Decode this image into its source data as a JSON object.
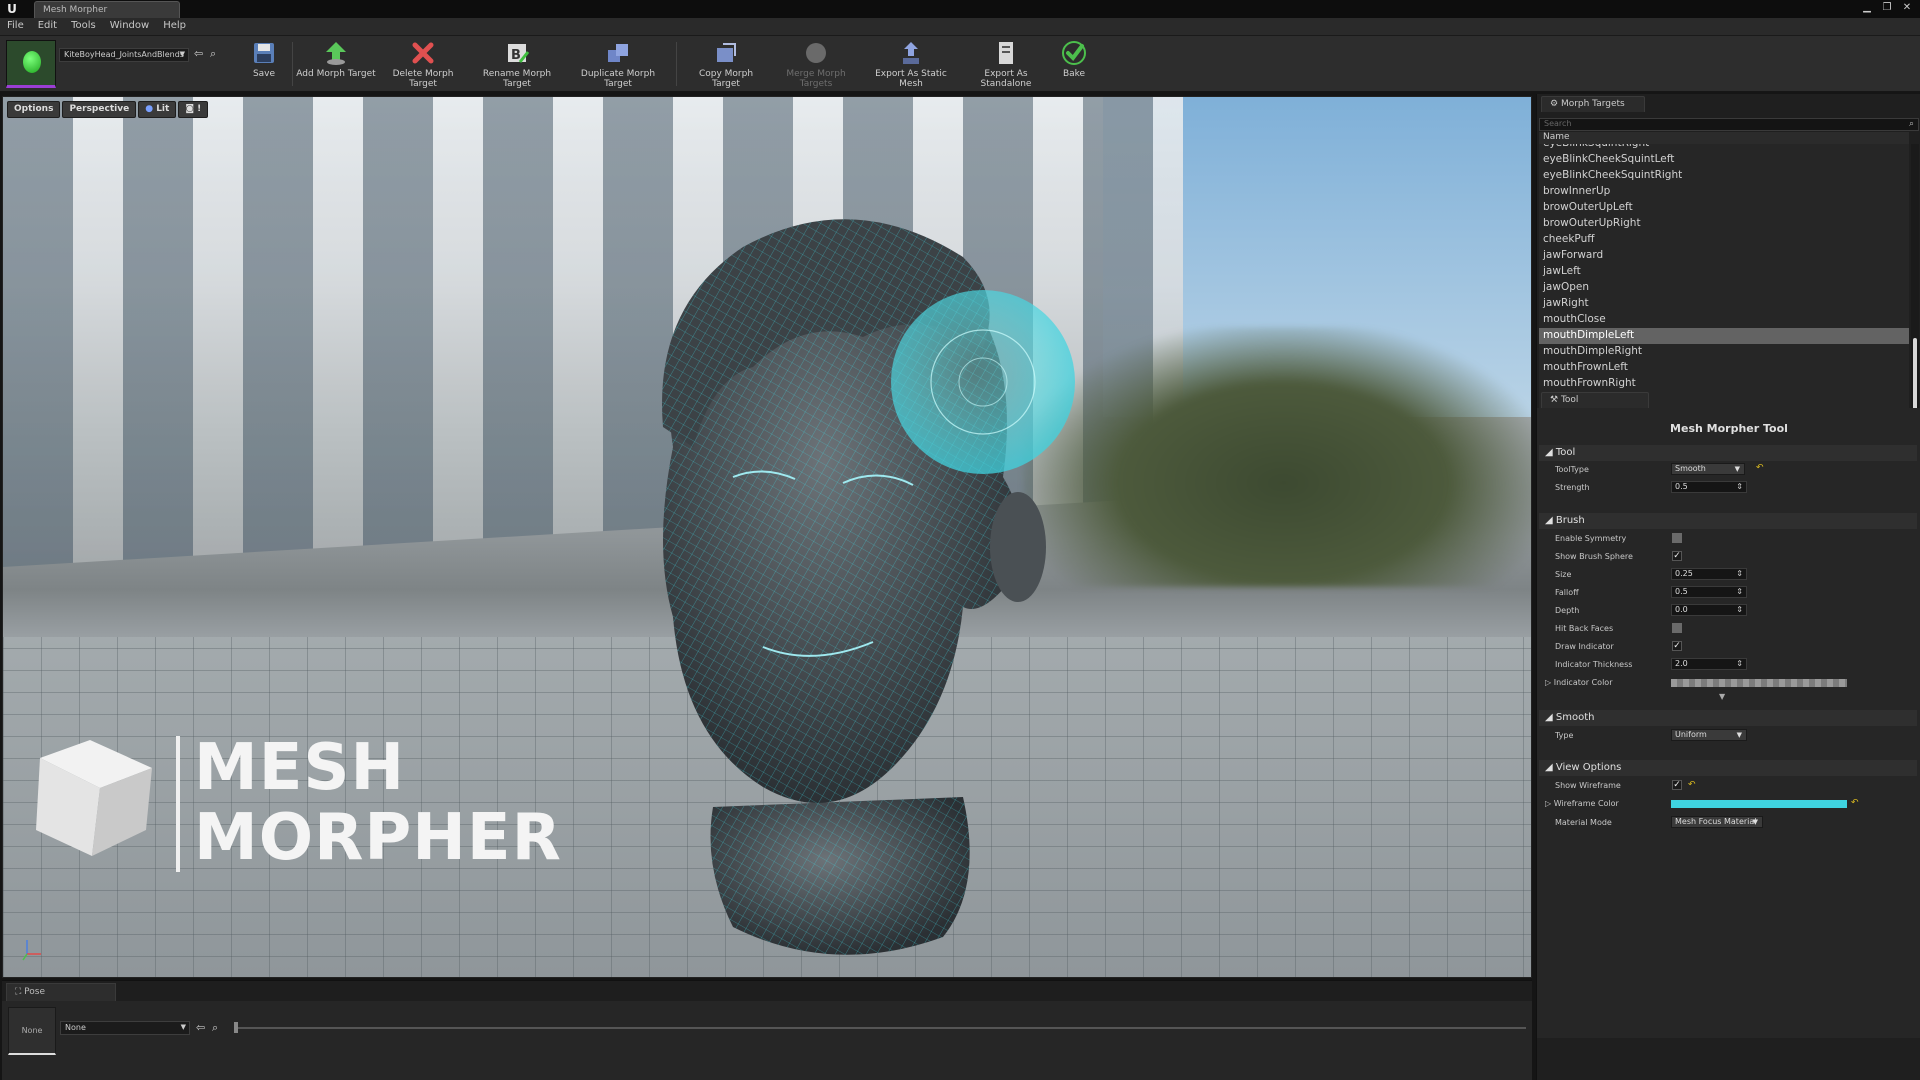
{
  "titlebar": {
    "tab_label": "Mesh Morpher"
  },
  "menu": [
    "File",
    "Edit",
    "Tools",
    "Window",
    "Help"
  ],
  "asset": {
    "name": "KiteBoyHead_JointsAndBlends"
  },
  "toolbar": {
    "save": "Save",
    "add": "Add Morph Target",
    "delete": "Delete Morph Target",
    "rename": "Rename Morph Target",
    "duplicate": "Duplicate Morph Target",
    "copy": "Copy Morph Target",
    "merge": "Merge Morph Targets",
    "export_static": "Export As Static Mesh",
    "export_standalone": "Export As Standalone",
    "bake": "Bake"
  },
  "viewport": {
    "options": "Options",
    "perspective": "Perspective",
    "lit": "Lit"
  },
  "overlay": {
    "line1": "MESH",
    "line2": "MORPHER"
  },
  "pose": {
    "tab": "Pose",
    "thumb": "None",
    "combo": "None"
  },
  "morph_panel": {
    "tab": "Morph Targets",
    "search_placeholder": "Search",
    "column": "Name",
    "items": [
      "eyeBlinkSquintRight",
      "eyeBlinkCheekSquintLeft",
      "eyeBlinkCheekSquintRight",
      "browInnerUp",
      "browOuterUpLeft",
      "browOuterUpRight",
      "cheekPuff",
      "jawForward",
      "jawLeft",
      "jawOpen",
      "jawRight",
      "mouthClose",
      "mouthDimpleLeft",
      "mouthDimpleRight",
      "mouthFrownLeft",
      "mouthFrownRight"
    ],
    "selected": "mouthDimpleLeft"
  },
  "tool_panel": {
    "tab": "Tool",
    "title": "Mesh Morpher Tool",
    "sections": {
      "tool": "Tool",
      "brush": "Brush",
      "smooth": "Smooth",
      "view": "View Options"
    },
    "labels": {
      "tool_type": "ToolType",
      "strength": "Strength",
      "enable_symmetry": "Enable Symmetry",
      "show_brush_sphere": "Show Brush Sphere",
      "size": "Size",
      "falloff": "Falloff",
      "depth": "Depth",
      "hit_back_faces": "Hit Back Faces",
      "draw_indicator": "Draw Indicator",
      "indicator_thickness": "Indicator Thickness",
      "indicator_color": "Indicator Color",
      "type": "Type",
      "show_wireframe": "Show Wireframe",
      "wireframe_color": "Wireframe Color",
      "material_mode": "Material Mode"
    },
    "values": {
      "tool_type": "Smooth",
      "strength": "0.5",
      "size": "0.25",
      "falloff": "0.5",
      "depth": "0.0",
      "indicator_thickness": "2.0",
      "type": "Uniform",
      "material_mode": "Mesh Focus Material"
    },
    "checks": {
      "enable_symmetry": false,
      "show_brush_sphere": true,
      "hit_back_faces": false,
      "draw_indicator": true,
      "show_wireframe": true
    },
    "colors": {
      "wireframe": "#3fd3e0",
      "indicator": "#9a9a9a"
    }
  }
}
